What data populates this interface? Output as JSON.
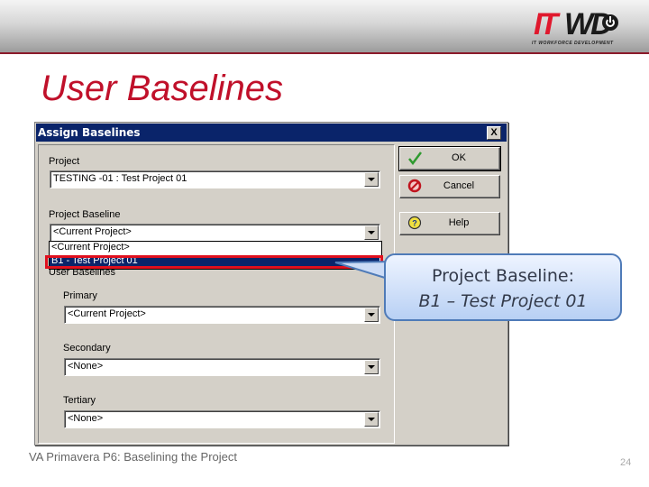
{
  "logo": {
    "left": "IT",
    "right": "WD",
    "tagline": "IT WORKFORCE DEVELOPMENT"
  },
  "slide_title": "User Baselines",
  "dialog": {
    "title": "Assign Baselines",
    "close_label": "X",
    "project": {
      "label": "Project",
      "value": "TESTING -01 : Test Project 01"
    },
    "project_baseline": {
      "label": "Project Baseline",
      "value": "<Current Project>",
      "options": [
        "<Current Project>",
        "B1 - Test Project 01"
      ],
      "highlighted_option": "B1 - Test Project 01"
    },
    "user_baselines": {
      "label": "User Baselines",
      "primary": {
        "label": "Primary",
        "value": "<Current Project>"
      },
      "secondary": {
        "label": "Secondary",
        "value": "<None>"
      },
      "tertiary": {
        "label": "Tertiary",
        "value": "<None>"
      }
    },
    "buttons": {
      "ok": "OK",
      "cancel": "Cancel",
      "help": "Help"
    }
  },
  "callout": {
    "line1": "Project Baseline:",
    "line2": "B1 – Test Project 01"
  },
  "footer": {
    "text": "VA Primavera P6: Baselining the Project",
    "page_number": "24"
  },
  "colors": {
    "title_red": "#c0102a",
    "titlebar_blue": "#0a246a",
    "highlight_red": "#e0101e",
    "callout_border": "#4f7bb8"
  }
}
